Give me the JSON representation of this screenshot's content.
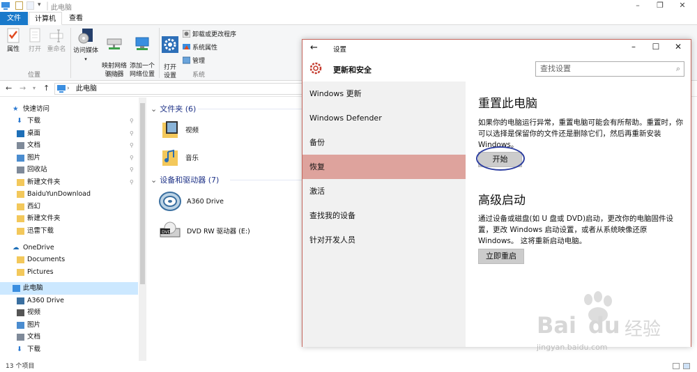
{
  "explorer": {
    "title": "此电脑",
    "ribbon_tabs": [
      "文件",
      "计算机",
      "查看"
    ],
    "ribbon_buttons": {
      "properties": "属性",
      "open": "打开",
      "rename": "重命名",
      "access_media": "访问媒体",
      "map_drive": "映射网络\n驱动器",
      "add_location": "添加一个\n网络位置",
      "open_settings": "打开\n设置",
      "uninstall": "卸载或更改程序",
      "sys_props": "系统属性",
      "manage": "管理"
    },
    "ribbon_groups": [
      "位置",
      "网络",
      "系统"
    ],
    "address": "此电脑",
    "sidebar": [
      {
        "label": "快速访问",
        "icon": "star-icon",
        "color": "#2b79d1",
        "indent": 0,
        "pin": false,
        "selected": false
      },
      {
        "label": "下载",
        "icon": "download-icon",
        "color": "#2b79d1",
        "indent": 1,
        "pin": true,
        "selected": false
      },
      {
        "label": "桌面",
        "icon": "desktop-icon",
        "color": "#1e6fb8",
        "indent": 1,
        "pin": true,
        "selected": false
      },
      {
        "label": "文档",
        "icon": "document-icon",
        "color": "#7f8a99",
        "indent": 1,
        "pin": true,
        "selected": false
      },
      {
        "label": "图片",
        "icon": "picture-icon",
        "color": "#4a8ccf",
        "indent": 1,
        "pin": true,
        "selected": false
      },
      {
        "label": "回收站",
        "icon": "recycle-bin-icon",
        "color": "#7f8a99",
        "indent": 1,
        "pin": true,
        "selected": false
      },
      {
        "label": "新建文件夹",
        "icon": "folder-icon",
        "color": "#f3c85b",
        "indent": 1,
        "pin": true,
        "selected": false
      },
      {
        "label": "BaiduYunDownload",
        "icon": "folder-icon",
        "color": "#f3c85b",
        "indent": 1,
        "pin": false,
        "selected": false
      },
      {
        "label": "西幻",
        "icon": "folder-icon",
        "color": "#f3c85b",
        "indent": 1,
        "pin": false,
        "selected": false
      },
      {
        "label": "新建文件夹",
        "icon": "folder-icon",
        "color": "#f3c85b",
        "indent": 1,
        "pin": false,
        "selected": false
      },
      {
        "label": "迅雷下载",
        "icon": "folder-icon",
        "color": "#f3c85b",
        "indent": 1,
        "pin": false,
        "selected": false
      },
      {
        "label": "OneDrive",
        "icon": "cloud-icon",
        "color": "#1e6fb8",
        "indent": 0,
        "pin": false,
        "selected": false
      },
      {
        "label": "Documents",
        "icon": "folder-icon",
        "color": "#f3c85b",
        "indent": 1,
        "pin": false,
        "selected": false
      },
      {
        "label": "Pictures",
        "icon": "folder-icon",
        "color": "#f3c85b",
        "indent": 1,
        "pin": false,
        "selected": false
      },
      {
        "label": "此电脑",
        "icon": "computer-icon",
        "color": "#3a8ee0",
        "indent": 0,
        "pin": false,
        "selected": true
      },
      {
        "label": "A360 Drive",
        "icon": "a360-icon",
        "color": "#3a6fa0",
        "indent": 1,
        "pin": false,
        "selected": false
      },
      {
        "label": "视频",
        "icon": "video-icon",
        "color": "#555",
        "indent": 1,
        "pin": false,
        "selected": false
      },
      {
        "label": "图片",
        "icon": "picture-icon",
        "color": "#4a8ccf",
        "indent": 1,
        "pin": false,
        "selected": false
      },
      {
        "label": "文档",
        "icon": "document-icon",
        "color": "#7f8a99",
        "indent": 1,
        "pin": false,
        "selected": false
      },
      {
        "label": "下载",
        "icon": "download-icon",
        "color": "#2b79d1",
        "indent": 1,
        "pin": false,
        "selected": false
      }
    ],
    "folders_header": "文件夹 (6)",
    "folders": [
      "视频",
      "音乐"
    ],
    "devices_header": "设备和驱动器 (7)",
    "devices": [
      "A360 Drive",
      "DVD RW 驱动器 (E:)"
    ],
    "status": "13 个项目"
  },
  "settings": {
    "window_title": "设置",
    "section_title": "更新和安全",
    "search_placeholder": "查找设置",
    "nav": [
      {
        "label": "Windows 更新",
        "selected": false
      },
      {
        "label": "Windows Defender",
        "selected": false
      },
      {
        "label": "备份",
        "selected": false
      },
      {
        "label": "恢复",
        "selected": true
      },
      {
        "label": "激活",
        "selected": false
      },
      {
        "label": "查找我的设备",
        "selected": false
      },
      {
        "label": "针对开发人员",
        "selected": false
      }
    ],
    "reset_title": "重置此电脑",
    "reset_desc": "如果你的电脑运行异常，重置电脑可能会有所帮助。重置时，你可以选择是保留你的文件还是删除它们，然后再重新安装 Windows。",
    "reset_button": "开始",
    "advanced_title": "高级启动",
    "advanced_desc": "通过设备或磁盘(如 U 盘或 DVD)启动，更改你的电脑固件设置，更改 Windows 启动设置，或者从系统映像还原 Windows。 这将重新启动电脑。",
    "restart_button": "立即重启"
  },
  "watermark": {
    "brand": "Bai",
    "brand2": "du",
    "jingyan": "经验",
    "url": "jingyan.baidu.com"
  },
  "colors": {
    "accent": "#1979ca",
    "selected_nav": "#dea39d",
    "window_border": "#c5655c",
    "annotation_circle": "#2d3ea0"
  }
}
